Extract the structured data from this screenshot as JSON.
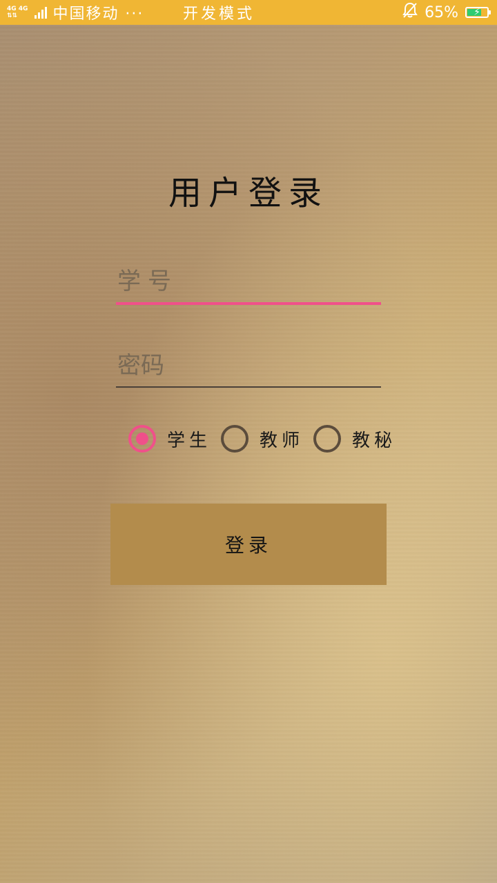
{
  "status_bar": {
    "network": "4G 4G",
    "carrier": "中国移动 ···",
    "center_text": "开发模式",
    "battery_percent": "65%",
    "battery_level": 0.65,
    "background_color": "#f0b634"
  },
  "login": {
    "title": "用户登录",
    "username_placeholder": "学号",
    "password_placeholder": "密码",
    "roles": [
      {
        "label": "学生",
        "selected": true
      },
      {
        "label": "教师",
        "selected": false
      },
      {
        "label": "教秘",
        "selected": false
      }
    ],
    "submit_label": "登录",
    "accent_color": "#f0508a",
    "button_color": "#b38c4c"
  }
}
